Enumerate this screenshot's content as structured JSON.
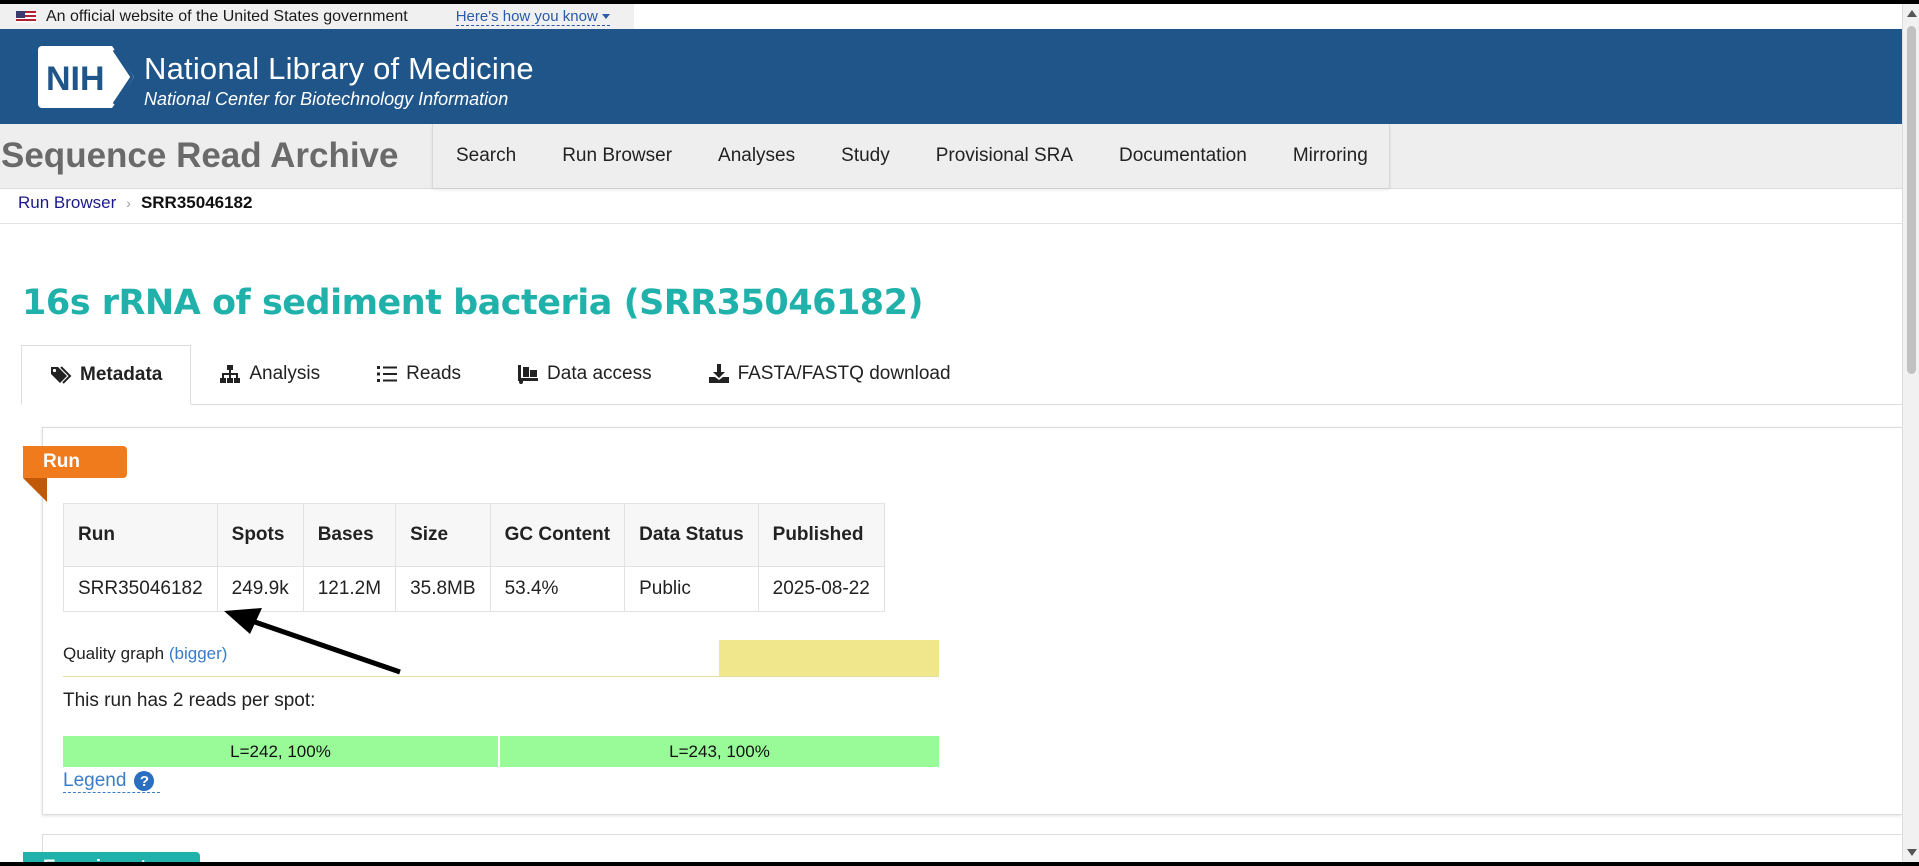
{
  "gov_banner": {
    "text": "An official website of the United States government",
    "howto": "Here's how you know"
  },
  "header": {
    "logo_text": "NIH",
    "title": "National Library of Medicine",
    "subtitle": "National Center for Biotechnology Information"
  },
  "sra": {
    "title": "Sequence Read Archive",
    "nav": [
      "Search",
      "Run Browser",
      "Analyses",
      "Study",
      "Provisional SRA",
      "Documentation",
      "Mirroring"
    ]
  },
  "breadcrumb": {
    "parent": "Run Browser",
    "current": "SRR35046182"
  },
  "page": {
    "title": "16s rRNA of sediment bacteria (SRR35046182)"
  },
  "tabs": [
    {
      "label": "Metadata",
      "icon": "tags-icon",
      "active": true
    },
    {
      "label": "Analysis",
      "icon": "sitemap-icon",
      "active": false
    },
    {
      "label": "Reads",
      "icon": "list-icon",
      "active": false
    },
    {
      "label": "Data access",
      "icon": "truck-loading-icon",
      "active": false
    },
    {
      "label": "FASTA/FASTQ download",
      "icon": "download-icon",
      "active": false
    }
  ],
  "run_section": {
    "ribbon": "Run",
    "columns": [
      "Run",
      "Spots",
      "Bases",
      "Size",
      "GC Content",
      "Data Status",
      "Published"
    ],
    "rows": [
      [
        "SRR35046182",
        "249.9k",
        "121.2M",
        "35.8MB",
        "53.4%",
        "Public",
        "2025-08-22"
      ]
    ],
    "quality_label": "Quality graph",
    "quality_link": "(bigger)",
    "reads_text": "This run has 2 reads per spot:",
    "reads": [
      {
        "label": "L=242, 100%",
        "fraction": 0.5
      },
      {
        "label": "L=243, 100%",
        "fraction": 0.5
      }
    ],
    "legend": "Legend"
  },
  "next_section": {
    "ribbon": "Experiment"
  },
  "colors": {
    "nlm_blue": "#20558a",
    "title_teal": "#20b2aa",
    "run_orange": "#f07b1d",
    "read_green": "#98fb98",
    "quality_yellow": "#f0e68c"
  }
}
